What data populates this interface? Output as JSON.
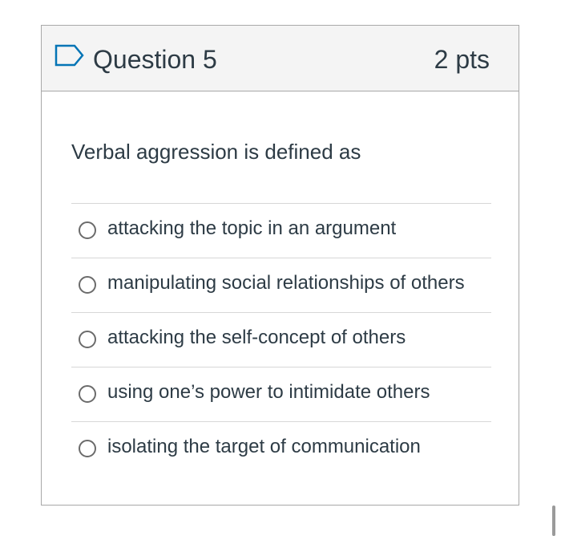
{
  "question": {
    "title": "Question 5",
    "points": "2 pts",
    "text": "Verbal aggression is defined as",
    "flag_icon": "flag-outline-icon",
    "accent_color": "#0374b5"
  },
  "answers": [
    {
      "label": "attacking the topic in an argument",
      "selected": false
    },
    {
      "label": "manipulating social relationships of others",
      "selected": false
    },
    {
      "label": "attacking the self-concept of others",
      "selected": false
    },
    {
      "label": "using one’s power to intimidate others",
      "selected": false
    },
    {
      "label": "isolating the target of communication",
      "selected": false
    }
  ]
}
